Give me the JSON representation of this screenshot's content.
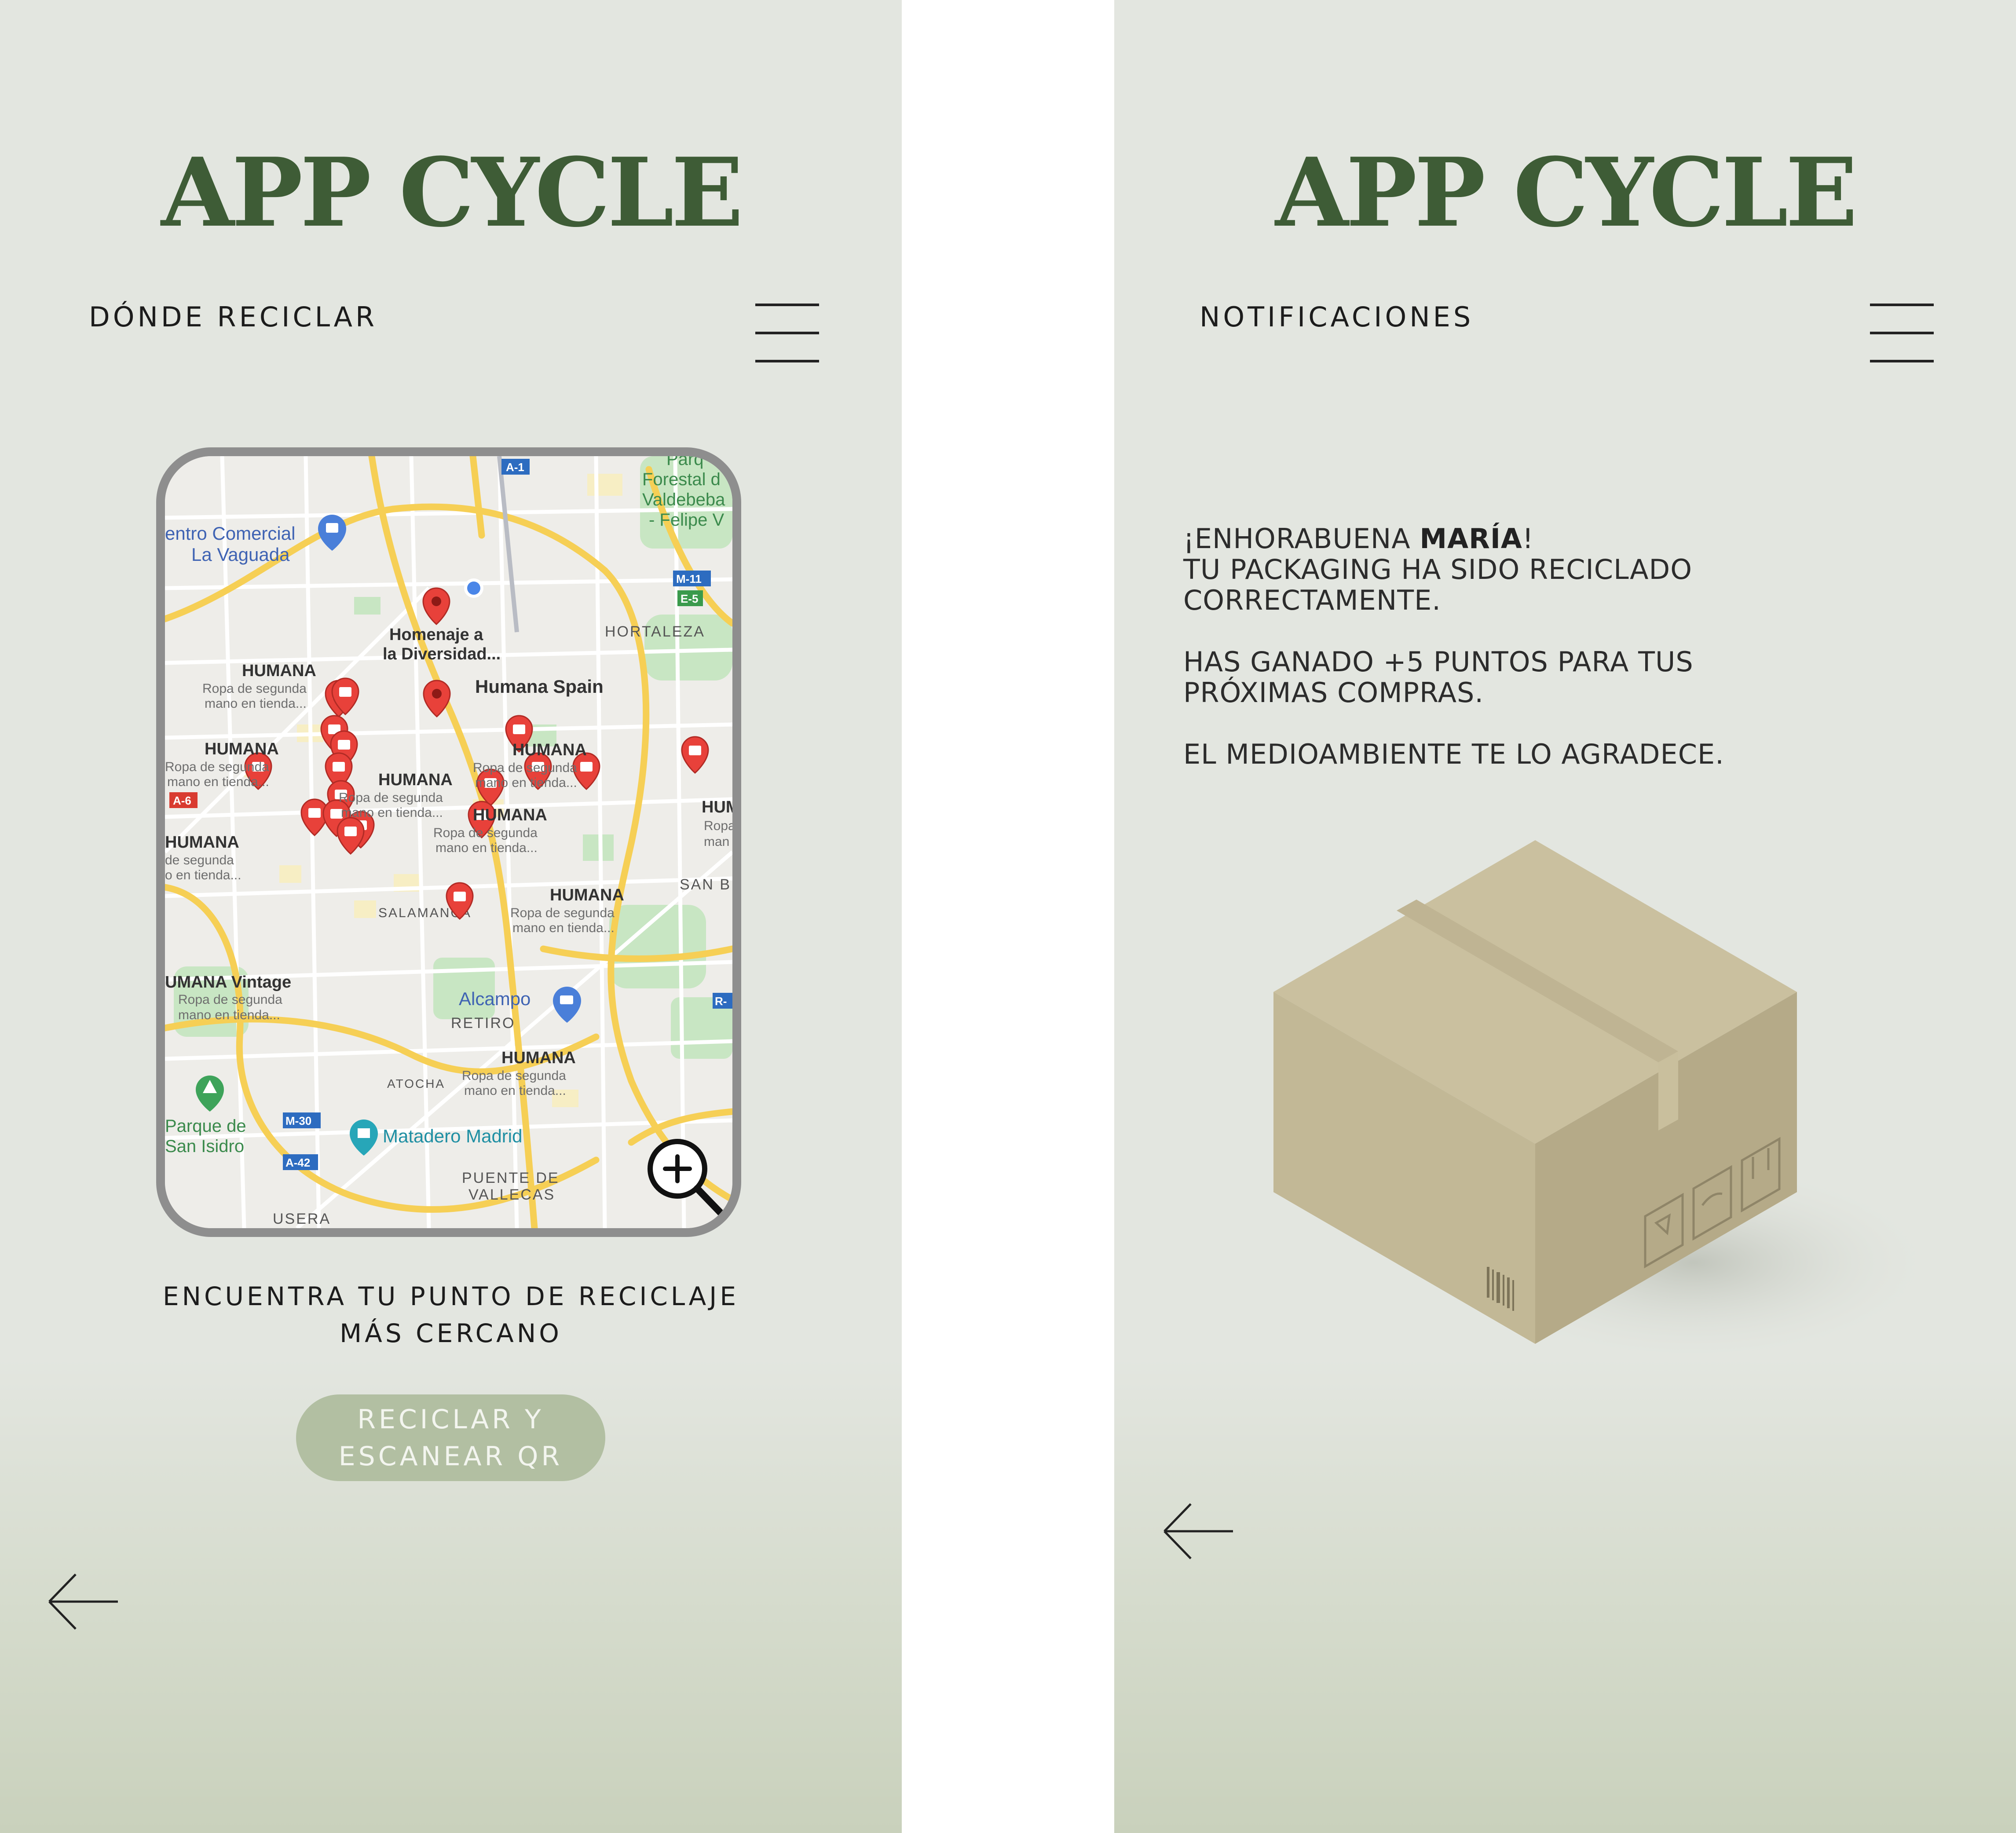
{
  "left_screen": {
    "logo": "APP CYCLE",
    "title": "DÓNDE RECICLAR",
    "caption_line1": "ENCUENTRA TU PUNTO DE RECICLAJE",
    "caption_line2": "MÁS CERCANO",
    "button_line1": "RECICLAR Y",
    "button_line2": "ESCANEAR QR",
    "map": {
      "place_labels": {
        "centro_comercial_1": "entro Comercial",
        "centro_comercial_2": "La Vaguada",
        "parque_forestal_1": "Parq",
        "parque_forestal_2": "Forestal d",
        "parque_forestal_3": "Valdebeba",
        "parque_forestal_4": "- Felipe V",
        "homenaje_1": "Homenaje a",
        "homenaje_2": "la Diversidad...",
        "hortaleza": "HORTALEZA",
        "humana_spain": "Humana Spain",
        "salamanca": "SALAMANCA",
        "san_b": "SAN B",
        "alcampo": "Alcampo",
        "retiro": "RETIRO",
        "atocha": "ATOCHA",
        "parque_san_isidro_1": "Parque de",
        "parque_san_isidro_2": "San Isidro",
        "matadero": "Matadero Madrid",
        "puente_vallecas_1": "PUENTE DE",
        "puente_vallecas_2": "VALLECAS",
        "usera": "USERA",
        "humana_vintage": "UMANA Vintage",
        "hum_partial": "HUM",
        "ropa_partial": "Ropa",
        "mano_partial": "man"
      },
      "store_name": "HUMANA",
      "store_desc_1": "Ropa de segunda",
      "store_desc_2": "mano en tienda...",
      "store_desc_left_1": "de segunda",
      "store_desc_left_2": "o en tienda...",
      "road_badges": {
        "a1": "A-1",
        "m11": "M-11",
        "e5": "E-5",
        "a6": "A-6",
        "m30": "M-30",
        "a42": "A-42",
        "r": "R-"
      }
    }
  },
  "right_screen": {
    "logo": "APP CYCLE",
    "title": "NOTIFICACIONES",
    "message": {
      "greeting_prefix": "¡ENHORABUENA ",
      "name": "MARÍA",
      "greeting_suffix": "!",
      "line2": "TU PACKAGING HA SIDO RECICLADO",
      "line3": "CORRECTAMENTE.",
      "points_line1": "HAS GANADO +5 PUNTOS PARA TUS",
      "points_line2": "PRÓXIMAS COMPRAS.",
      "closing": "EL MEDIOAMBIENTE TE LO AGRADECE."
    }
  },
  "colors": {
    "brand_green": "#3e5c36",
    "button_green": "#b2bfa2",
    "background": "#e3e6e0",
    "pin_red": "#e8413a",
    "cardboard": "#c9bf9e"
  },
  "icons": {
    "menu": "hamburger-menu-icon",
    "back": "back-arrow-icon",
    "zoom": "zoom-in-icon",
    "pin": "map-pin-icon",
    "box": "cardboard-box-illustration"
  }
}
